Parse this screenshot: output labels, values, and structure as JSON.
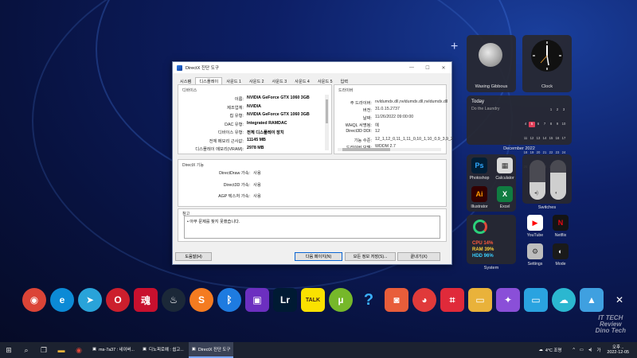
{
  "dialog": {
    "title": "DirectX 진단 도구",
    "tabs": [
      "시스템",
      "디스플레이",
      "사운드 1",
      "사운드 2",
      "사운드 3",
      "사운드 4",
      "사운드 5",
      "입력"
    ],
    "device_group": "디바이스",
    "driver_group": "드라이버",
    "device": [
      {
        "k": "이름:",
        "v": "NVIDIA GeForce GTX 1060 3GB"
      },
      {
        "k": "제조업체:",
        "v": "NVIDIA"
      },
      {
        "k": "칩 유형:",
        "v": "NVIDIA GeForce GTX 1060 3GB"
      },
      {
        "k": "DAC 유형:",
        "v": "Integrated RAMDAC"
      },
      {
        "k": "디바이스 유형:",
        "v": "전체 디스플레이 장치"
      },
      {
        "k": "전체 메모리 근사값:",
        "v": "11145 MB"
      },
      {
        "k": "디스플레이 메모리(VRAM):",
        "v": "2978 MB"
      }
    ],
    "driver": [
      {
        "k": "주 드라이버:",
        "v": "nvldumdx.dll,nvldumdx.dll,nvldumdx.dll"
      },
      {
        "k": "버전:",
        "v": "31.0.15.2737"
      },
      {
        "k": "날짜:",
        "v": "11/26/2022 09:00:00"
      },
      {
        "k": "WHQL 서명됨:",
        "v": "예"
      },
      {
        "k": "Direct3D DDI:",
        "v": "12"
      },
      {
        "k": "기능 수준:",
        "v": "12_1,12_0,11_1,11_0,10_1,10_0,9_3,9_2"
      },
      {
        "k": "드라이버 모델:",
        "v": "WDDM 2.7"
      }
    ],
    "features_group": "DirectX 기능",
    "features": [
      {
        "k": "DirectDraw 가속:",
        "v": "사용"
      },
      {
        "k": "Direct3D 가속:",
        "v": "사용"
      },
      {
        "k": "AGP 텍스처 가속:",
        "v": "사용"
      }
    ],
    "notes_group": "참고",
    "notes_text": "아무 문제를 찾지 못했습니다.",
    "buttons": {
      "help": "도움말(H)",
      "next": "다음 페이지(N)",
      "save": "모든 정보 저장(S)...",
      "exit": "끝내기(X)"
    }
  },
  "widgets": {
    "moon_label": "Waxing Gibbous",
    "clock_label": "Clock",
    "today_title": "Today",
    "today_item": "Do the Laundry",
    "calendar_label": "December 2022",
    "calendar_highlight": "5",
    "apps_left": [
      {
        "name": "Photoshop",
        "glyph": "Ps",
        "bg": "#001e36",
        "fg": "#31a8ff"
      },
      {
        "name": "Calculator",
        "glyph": "▦",
        "bg": "#d9d9d9",
        "fg": "#333333"
      },
      {
        "name": "Illustrator",
        "glyph": "Ai",
        "bg": "#330000",
        "fg": "#ff9a00"
      },
      {
        "name": "Excel",
        "glyph": "X",
        "bg": "#107c41",
        "fg": "#ffffff"
      }
    ],
    "switches_label": "Switches",
    "system": {
      "cpu": "CPU 14%",
      "ram": "RAM 39%",
      "hdd": "HDD 96%",
      "label": "System"
    },
    "apps_right": [
      {
        "name": "YouTube",
        "glyph": "▶",
        "bg": "#ffffff",
        "fg": "#ff0000"
      },
      {
        "name": "Netflix",
        "glyph": "N",
        "bg": "#141414",
        "fg": "#e50914"
      },
      {
        "name": "Settings",
        "glyph": "⚙",
        "bg": "#bdbdbd",
        "fg": "#333333"
      },
      {
        "name": "Mode",
        "glyph": "◐",
        "bg": "#1a1a1a",
        "fg": "#ffffff"
      }
    ]
  },
  "dock": [
    {
      "name": "chrome-icon",
      "glyph": "◉",
      "bg": "#db4437",
      "sq": false
    },
    {
      "name": "edge-icon",
      "glyph": "e",
      "bg": "#0c8ad6",
      "sq": false
    },
    {
      "name": "bird-app-icon",
      "glyph": "➤",
      "bg": "#29a3d9",
      "sq": false
    },
    {
      "name": "opera-icon",
      "glyph": "O",
      "bg": "#cc1f2d",
      "sq": false
    },
    {
      "name": "stamp-app-icon",
      "glyph": "魂",
      "bg": "#c8102e",
      "sq": true
    },
    {
      "name": "steam-icon",
      "glyph": "♨",
      "bg": "#1b2838",
      "sq": false
    },
    {
      "name": "s-app-icon",
      "glyph": "S",
      "bg": "#f47b20",
      "sq": false
    },
    {
      "name": "bluetooth-icon",
      "glyph": "ᛒ",
      "bg": "#1e7be0",
      "sq": false
    },
    {
      "name": "chip-app-icon",
      "glyph": "▣",
      "bg": "#6c2fc0",
      "sq": true
    },
    {
      "name": "lightroom-icon",
      "glyph": "Lr",
      "bg": "#001a33",
      "sq": true
    },
    {
      "name": "kakaotalk-icon",
      "glyph": "TALK",
      "bg": "#fae100",
      "sq": true
    },
    {
      "name": "utorrent-icon",
      "glyph": "µ",
      "bg": "#76b82a",
      "sq": false
    },
    {
      "name": "help-icon",
      "glyph": "?",
      "bg": "transparent",
      "sq": false
    },
    {
      "name": "snapshot-app-icon",
      "glyph": "◙",
      "bg": "#e85d3a",
      "sq": true
    },
    {
      "name": "gom-icon",
      "glyph": "◕",
      "bg": "#e03a3a",
      "sq": false
    },
    {
      "name": "crop-app-icon",
      "glyph": "⌗",
      "bg": "#e02a3a",
      "sq": true
    },
    {
      "name": "folder-icon",
      "glyph": "▭",
      "bg": "#e9b23a",
      "sq": true
    },
    {
      "name": "color-app-icon",
      "glyph": "✦",
      "bg": "#8a4fd8",
      "sq": true
    },
    {
      "name": "monitor-app-icon",
      "glyph": "▭",
      "bg": "#2aa3e0",
      "sq": true
    },
    {
      "name": "cloud-app-icon",
      "glyph": "☁",
      "bg": "#2bb7d0",
      "sq": false
    },
    {
      "name": "photo-app-icon",
      "glyph": "▲",
      "bg": "#3fa0e0",
      "sq": true
    },
    {
      "name": "tools-app-icon",
      "glyph": "✕",
      "bg": "transparent",
      "sq": false
    },
    {
      "name": "recycle-bin-icon",
      "glyph": "♲",
      "bg": "transparent",
      "sq": false
    }
  ],
  "taskbar": {
    "tasks": [
      {
        "label": "ms-7a37 : 네이버..."
      },
      {
        "label": "디노피로예 : 쉽고..."
      },
      {
        "label": "DirectX 진단 도구"
      }
    ],
    "weather": "4°C 조명",
    "time": "오후 ..",
    "date": "2022-12-05"
  },
  "watermark": "IT TECH Review Dino Tech"
}
